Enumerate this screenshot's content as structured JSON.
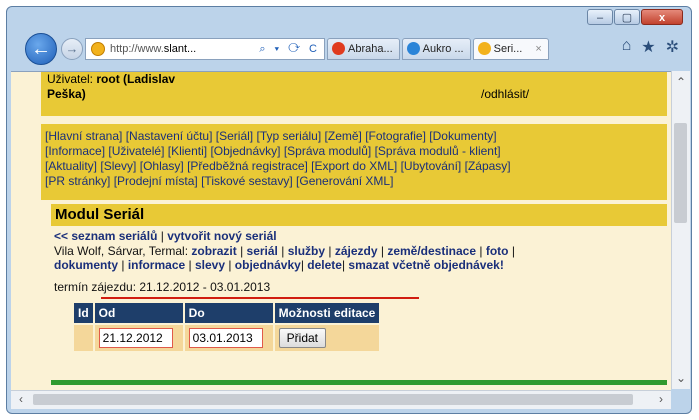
{
  "window": {
    "minimize": "–",
    "maximize": "▢",
    "close": "x"
  },
  "address": {
    "url_prefix": "http://www.",
    "url_domain": "slant...",
    "tools": "⌕ ▾ ⟳ C"
  },
  "tabs": [
    {
      "label": "Abraha...",
      "icon_color": "#e03b1f"
    },
    {
      "label": "Aukro ...",
      "icon_color": "#2a84d8"
    },
    {
      "label": "Seri...",
      "icon_color": "#f2b21d",
      "close": "×"
    }
  ],
  "right_tools": {
    "home": "⌂",
    "favorites": "★",
    "settings": "✲"
  },
  "user": {
    "prefix": "Uživatel: ",
    "name_part1": "root (Ladislav",
    "name_part2": "Peška)",
    "logout": "/odhlásit/"
  },
  "nav_items": [
    "[Hlavní strana]",
    "[Nastavení účtu]",
    "[Seriál]",
    "[Typ seriálu]",
    "[Země]",
    "[Fotografie]",
    "[Dokumenty]",
    "[Informace]",
    "[Uživatelé]",
    "[Klienti]",
    "[Objednávky]",
    "[Správa modulů]",
    "[Správa modulů - klient]",
    "[Aktuality]",
    "[Slevy]",
    "[Ohlasy]",
    "[Předběžná registrace]",
    "[Export do XML]",
    "[Ubytování]",
    "[Zápasy]",
    "[PR stránky]",
    "[Prodejní místa]",
    "[Tiskové sestavy]",
    "[Generování XML]"
  ],
  "module": {
    "title": "Modul Seriál",
    "list_link": "<< seznam seriálů",
    "separator": " | ",
    "create_link": "vytvořit nový seriál",
    "serial_name": "Vila Wolf, Sárvar, Termal: ",
    "actions": [
      "zobrazit",
      "seriál",
      "služby",
      "zájezdy",
      "země/destinace",
      "foto",
      "dokumenty",
      "informace",
      "slevy",
      "objednávky",
      "delete",
      "smazat včetně objednávek!"
    ],
    "term_label": "termín zájezdu: ",
    "term_value": "21.12.2012 - 03.01.2013"
  },
  "table": {
    "headers": [
      "Id",
      "Od",
      "Do",
      "Možnosti editace"
    ],
    "row": {
      "id": "",
      "od": "21.12.2012",
      "do": "03.01.2013",
      "button": "Přidat"
    }
  },
  "colors": {
    "accent_yellow": "#e8c936",
    "header_navy": "#1e3e6a",
    "link_blue": "#1a2f7a",
    "alert_red": "#d11d10",
    "green_bar": "#2f9a2f"
  }
}
